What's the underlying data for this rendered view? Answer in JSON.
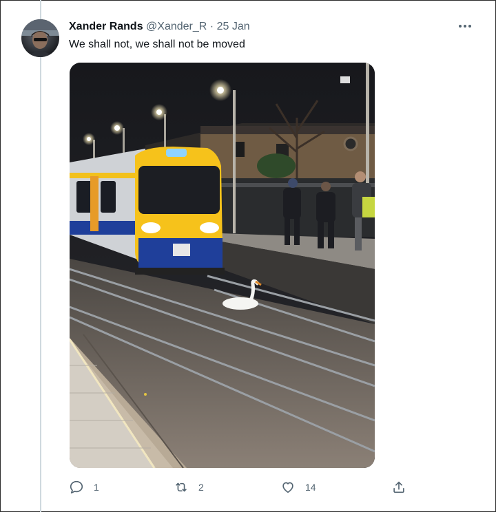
{
  "tweet": {
    "author_name": "Xander Rands",
    "handle": "@Xander_R",
    "separator": "·",
    "date": "25 Jan",
    "text": "We shall not, we shall not be moved",
    "media_alt": "A swan sits on the railway tracks in front of a yellow and blue train at a station platform at night"
  },
  "actions": {
    "replies": "1",
    "retweets": "2",
    "likes": "14"
  },
  "icons": {
    "more": "more-horizontal-icon",
    "reply": "reply-icon",
    "retweet": "retweet-icon",
    "like": "heart-icon",
    "share": "share-icon"
  },
  "colors": {
    "text_primary": "#0f1419",
    "text_secondary": "#536471",
    "thread_line": "#cfd9de"
  }
}
